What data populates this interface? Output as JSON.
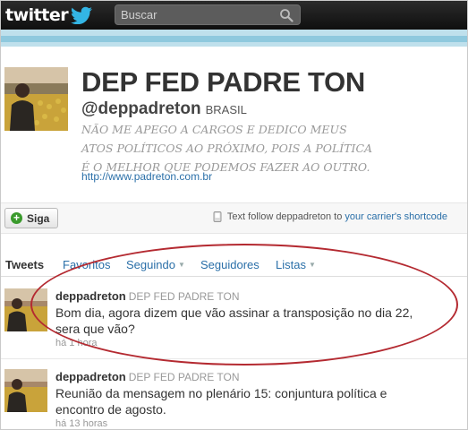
{
  "app": {
    "logo_text": "twitter"
  },
  "search": {
    "placeholder": "Buscar"
  },
  "profile": {
    "name": "DEP FED PADRE TON",
    "handle": "@deppadreton",
    "location": "BRASIL",
    "bio": "NÃO ME APEGO A CARGOS E DEDICO MEUS ATOS POLÍTICOS AO PRÓXIMO, POIS A POLÍTICA É O MELHOR QUE PODEMOS FAZER AO OUTRO.",
    "url": "http://www.padreton.com.br"
  },
  "follow": {
    "button_label": "Siga",
    "sms_text": "Text follow deppadreton",
    "sms_to": "to",
    "sms_link": "your carrier's shortcode"
  },
  "tabs": [
    {
      "label": "Tweets",
      "active": true
    },
    {
      "label": "Favoritos"
    },
    {
      "label": "Seguindo",
      "dropdown": true
    },
    {
      "label": "Seguidores"
    },
    {
      "label": "Listas",
      "dropdown": true
    }
  ],
  "tweets": [
    {
      "username": "deppadreton",
      "display_name": "DEP FED PADRE TON",
      "text": "Bom dia, agora dizem que vão assinar a transposição no dia 22, sera que vão?",
      "time": "há 1 hora"
    },
    {
      "username": "deppadreton",
      "display_name": "DEP FED PADRE TON",
      "text": "Reunião da mensagem no plenário 15: conjuntura política e encontro de agosto.",
      "time": "há 13 horas"
    }
  ],
  "colors": {
    "link": "#2a6fa8",
    "highlight_ellipse": "#b42a31",
    "band": "#bfe0ec"
  },
  "icons": [
    "twitter-bird-icon",
    "search-icon",
    "plus-icon",
    "phone-icon",
    "chevron-down-icon"
  ]
}
